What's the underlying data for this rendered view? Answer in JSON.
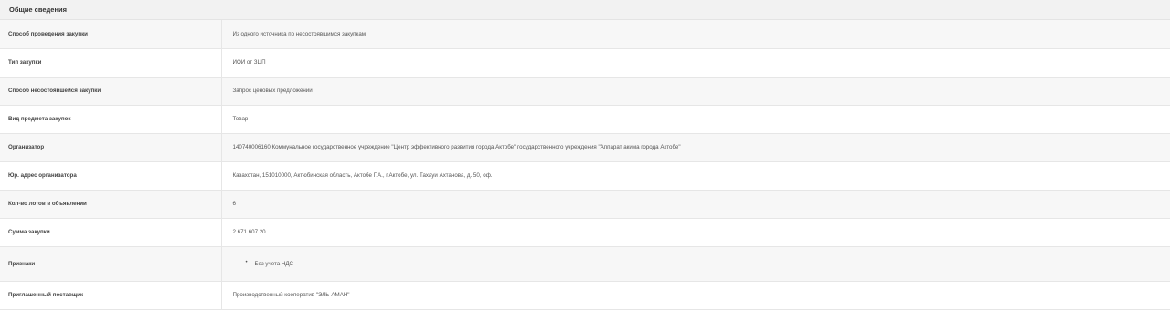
{
  "section": {
    "title": "Общие сведения"
  },
  "rows": [
    {
      "label": "Способ проведения закупки",
      "value": "Из одного источника по несостоявшимся закупкам"
    },
    {
      "label": "Тип закупки",
      "value": "ИОИ от ЗЦП"
    },
    {
      "label": "Способ несостоявшейся закупки",
      "value": "Запрос ценовых предложений"
    },
    {
      "label": "Вид предмета закупок",
      "value": "Товар"
    },
    {
      "label": "Организатор",
      "value": "140740006160 Коммунальное государственное учреждение \"Центр эффективного развития города Актобе\" государственного учреждения \"Аппарат акима города Актобе\""
    },
    {
      "label": "Юр. адрес организатора",
      "value": "Казахстан, 151010000, Актюбинская область, Актобе Г.А., г.Актобе, ул. Тахауи Ахтанова, д. 50, оф."
    },
    {
      "label": "Кол-во лотов в объявлении",
      "value": "6"
    },
    {
      "label": "Сумма закупки",
      "value": "2 671 607.20"
    },
    {
      "label": "Признаки",
      "items": [
        "Без учета НДС"
      ]
    },
    {
      "label": "Приглашенный поставщик",
      "value": "Производственный кооператив \"ЭЛЬ-АМАН\""
    }
  ]
}
